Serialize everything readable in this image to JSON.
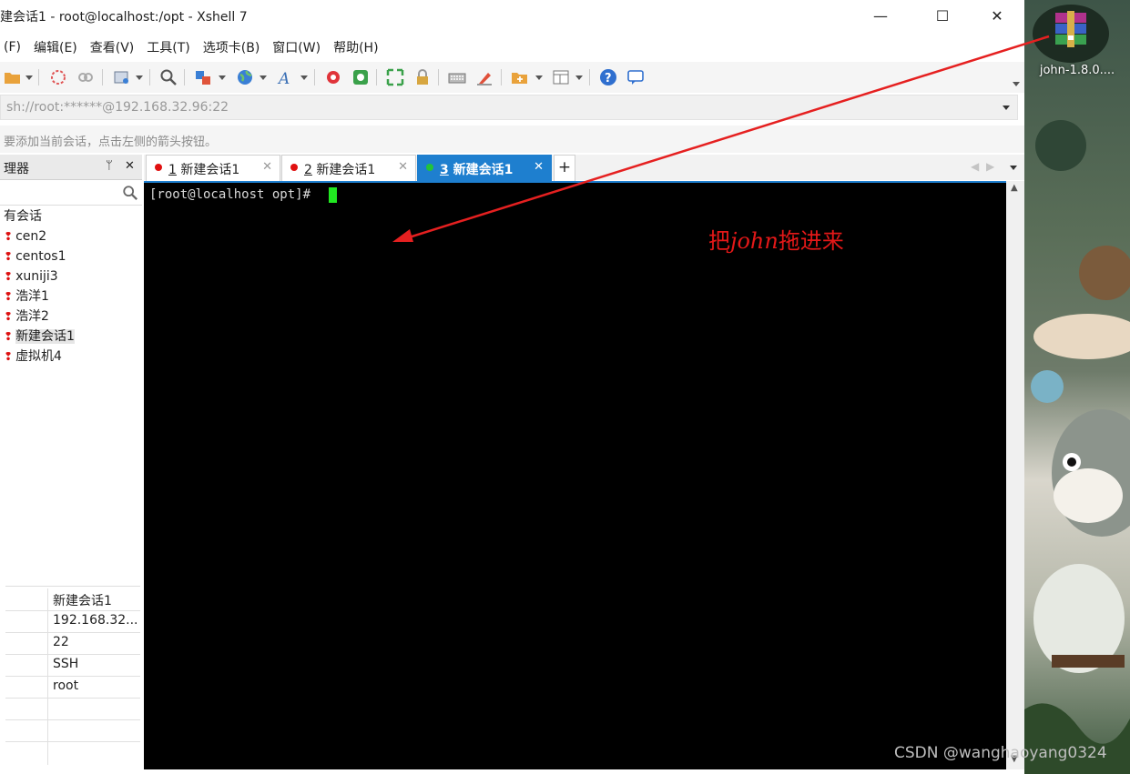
{
  "window": {
    "title": "建会话1 - root@localhost:/opt - Xshell 7",
    "minimize_glyph": "—",
    "maximize_glyph": "☐",
    "close_glyph": "✕"
  },
  "menu": [
    "(F)",
    "编辑(E)",
    "查看(V)",
    "工具(T)",
    "选项卡(B)",
    "窗口(W)",
    "帮助(H)"
  ],
  "address_bar": {
    "value": "sh://root:******@192.168.32.96:22"
  },
  "hint_bar": {
    "text": "要添加当前会话，点击左侧的箭头按钮。"
  },
  "session_manager": {
    "title": "理器",
    "pin_glyph": "ᛘ",
    "close_glyph": "✕",
    "tree": [
      {
        "label": "有会话",
        "selected": false
      },
      {
        "label": "cen2",
        "selected": false
      },
      {
        "label": "centos1",
        "selected": false
      },
      {
        "label": "xuniji3",
        "selected": false
      },
      {
        "label": "浩洋1",
        "selected": false
      },
      {
        "label": "浩洋2",
        "selected": false
      },
      {
        "label": "新建会话1",
        "selected": true
      },
      {
        "label": "虚拟机4",
        "selected": false
      }
    ],
    "properties": [
      "新建会话1",
      "192.168.32...",
      "22",
      "SSH",
      "root",
      "",
      ""
    ]
  },
  "tabs": [
    {
      "num": "1",
      "label": "新建会话1",
      "status_color": "#e01010",
      "active": false
    },
    {
      "num": "2",
      "label": "新建会话1",
      "status_color": "#e01010",
      "active": false
    },
    {
      "num": "3",
      "label": "新建会话1",
      "status_color": "#22c33a",
      "active": true
    }
  ],
  "tab_add_glyph": "+",
  "tab_close_glyph": "✕",
  "terminal": {
    "prompt": "[root@localhost opt]# "
  },
  "annotation": {
    "prefix": "把",
    "emphasis": "john",
    "suffix": "拖进来"
  },
  "desktop": {
    "icon_label": "john-1.8.0....",
    "icon": "winrar-archive-icon"
  },
  "watermark": "CSDN @wanghaoyang0324",
  "colors": {
    "accent": "#1e7fcf",
    "cursor": "#21e821",
    "annotation": "#e31818"
  }
}
